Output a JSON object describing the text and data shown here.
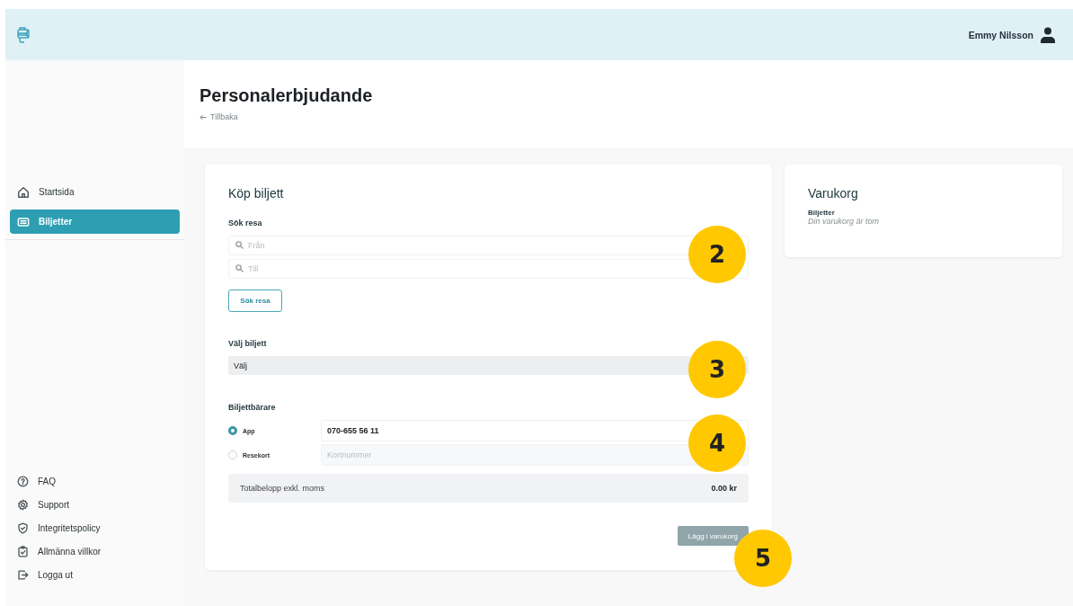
{
  "topbar": {
    "user_name": "Emmy Nilsson"
  },
  "sidebar": {
    "nav_items": [
      {
        "label": "Startsida",
        "selected": false
      },
      {
        "label": "Biljetter",
        "selected": true
      }
    ],
    "footer_items": [
      {
        "label": "FAQ"
      },
      {
        "label": "Support"
      },
      {
        "label": "Integritetspolicy"
      },
      {
        "label": "Allmänna villkor"
      },
      {
        "label": "Logga ut"
      }
    ]
  },
  "header": {
    "title": "Personalerbjudande",
    "back_link": "Tillbaka"
  },
  "purchase": {
    "title": "Köp biljett",
    "search_label": "Sök resa",
    "from_field": {
      "placeholder": "Från"
    },
    "to_field": {
      "placeholder": "Till"
    },
    "search_button": "Sök resa",
    "ticket_label": "Välj biljett",
    "ticket_select": {
      "value": "Välj"
    },
    "carrier_label": "Biljettbärare",
    "carriers": [
      {
        "label": "App",
        "selected": true,
        "value": "070-655 56 11"
      },
      {
        "label": "Resekort",
        "selected": false,
        "placeholder": "Kortnummer"
      }
    ],
    "total_label": "Totalbelopp exkl. moms",
    "total_value": "0.00 kr",
    "add_button": {
      "label": "Lägg i varukorg",
      "disabled": true
    }
  },
  "cart": {
    "title": "Varukorg",
    "section": "Biljetter",
    "empty_text": "Din varukorg är tom"
  },
  "callouts": [
    {
      "number": "2"
    },
    {
      "number": "3"
    },
    {
      "number": "4"
    },
    {
      "number": "5"
    }
  ]
}
